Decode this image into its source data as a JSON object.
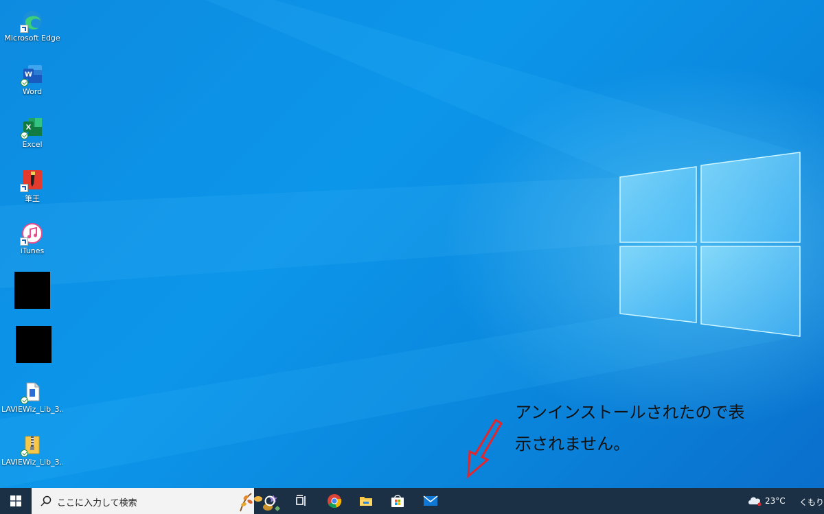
{
  "desktop": {
    "icons": [
      {
        "label": "Microsoft Edge",
        "icon": "edge-icon"
      },
      {
        "label": "Word",
        "icon": "word-icon"
      },
      {
        "label": "Excel",
        "icon": "excel-icon"
      },
      {
        "label": "筆王",
        "icon": "fudeoh-icon"
      },
      {
        "label": "iTunes",
        "icon": "itunes-icon"
      },
      {
        "label": "LAVIEWiz_Lib_3...",
        "icon": "document-icon"
      },
      {
        "label": "LAVIEWiz_Lib_3...",
        "icon": "zip-folder-icon"
      }
    ],
    "annotation": {
      "line1": "アンインストールされたので表",
      "line2": "示されません。",
      "arrow_color": "#e3262b"
    }
  },
  "taskbar": {
    "search_placeholder": "ここに入力して検索",
    "apps": [
      "cortana-icon",
      "task-view-icon",
      "chrome-icon",
      "file-explorer-icon",
      "microsoft-store-icon",
      "mail-icon"
    ],
    "weather": {
      "temperature": "23°C",
      "condition": "くもり",
      "icon": "cloud-icon"
    }
  },
  "colors": {
    "taskbar_bg": "#1b2f45",
    "desktop_accent": "#0a86dc"
  }
}
